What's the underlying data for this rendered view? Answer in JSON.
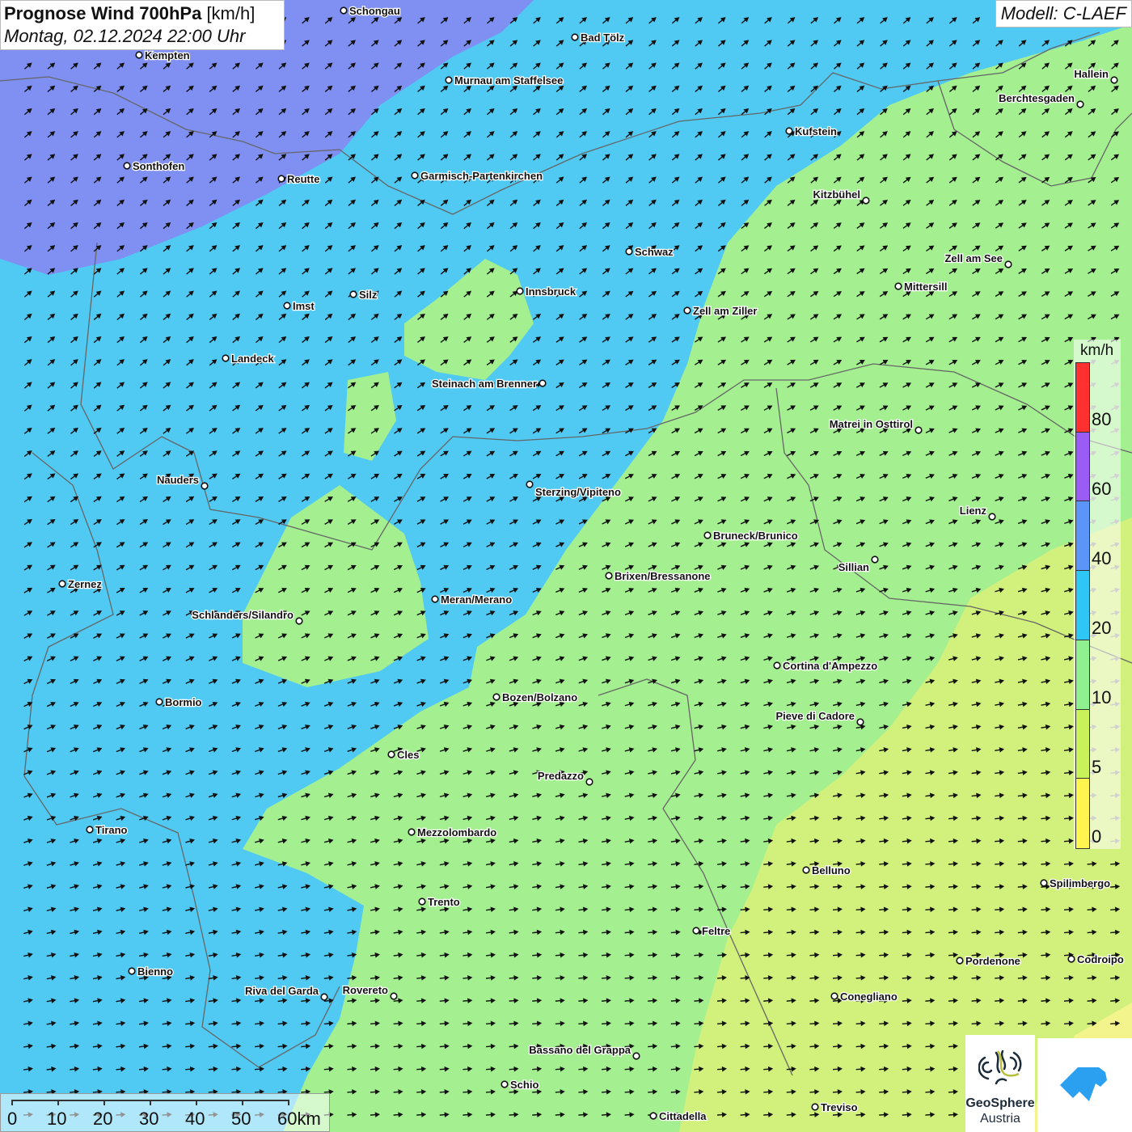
{
  "header": {
    "title_bold": "Prognose Wind 700hPa",
    "title_unit": "[km/h]",
    "datetime": "Montag, 02.12.2024 22:00 Uhr",
    "model": "Modell: C-LAEF"
  },
  "legend": {
    "unit": "km/h",
    "ticks": [
      "80",
      "60",
      "40",
      "20",
      "10",
      "5",
      "0"
    ],
    "colors": [
      "#ff3030",
      "#9b5cf6",
      "#5b95f7",
      "#2ec6f5",
      "#8ef08e",
      "#c9f25a",
      "#fff34f"
    ]
  },
  "scale_bar": {
    "labels": [
      "0",
      "10",
      "20",
      "30",
      "40",
      "50",
      "60km"
    ]
  },
  "logos": {
    "geosphere_line1": "GeoSphere",
    "geosphere_line2": "Austria"
  },
  "map": {
    "colors": {
      "band_60": "#7f8ff2",
      "band_20": "#50c9f3",
      "band_10": "#a4ef90",
      "band_5": "#d2f07c",
      "band_0": "#f3f58c"
    },
    "cities": [
      "Schongau",
      "Bad Tölz",
      "Kempten",
      "Murnau am Staffelsee",
      "Hallein",
      "Berchtesgaden",
      "Kufstein",
      "Sonthofen",
      "Reutte",
      "Garmisch-Partenkirchen",
      "Kitzbühel",
      "Schwaz",
      "Zell am See",
      "Innsbruck",
      "Mittersill",
      "Silz",
      "Imst",
      "Zell am Ziller",
      "Landeck",
      "Steinach am Brenner",
      "Matrei in Osttirol",
      "Nauders",
      "Sterzing/Vipiteno",
      "Lienz",
      "Bruneck/Brunico",
      "Sillian",
      "Brixen/Bressanone",
      "Zernez",
      "Meran/Merano",
      "Schlanders/Silandro",
      "Cortina d'Ampezzo",
      "Bozen/Bolzano",
      "Bormio",
      "Pieve di Cadore",
      "Cles",
      "Predazzo",
      "Tirano",
      "Mezzolombardo",
      "Belluno",
      "Spilimbergo",
      "Trento",
      "Feltre",
      "Pordenone",
      "Codroipo",
      "Bienno",
      "Riva del Garda",
      "Rovereto",
      "Conegliano",
      "Bassano del Grappa",
      "Schio",
      "Treviso",
      "Cittadella"
    ]
  }
}
